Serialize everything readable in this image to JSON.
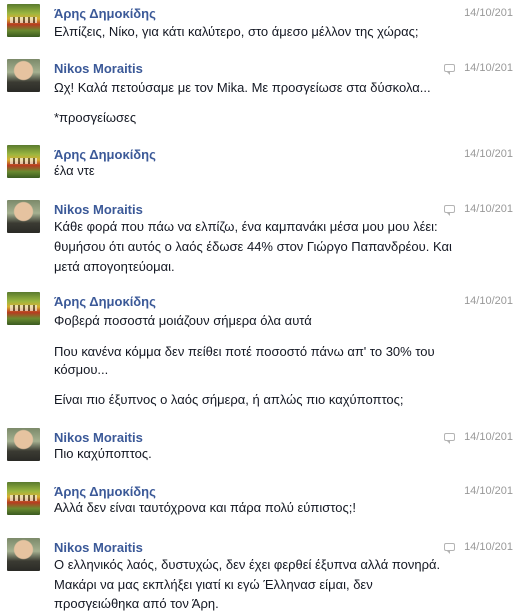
{
  "messages": [
    {
      "author": "Άρης Δημοκίδης",
      "avatar": "aris-avatar",
      "time": "14/10/201",
      "chat_icon": false,
      "lines": [
        "Ελπίζεις, Νίκο, για κάτι καλύτερο, στο άμεσο μέλλον της χώρας;"
      ]
    },
    {
      "author": "Nikos Moraitis",
      "avatar": "nikos-avatar",
      "time": "14/10/201",
      "chat_icon": true,
      "lines": [
        "Ωχ! Καλά πετούσαμε με τον Mika. Με προσγείωσε στα δύσκολα...",
        "*προσγείωσες"
      ]
    },
    {
      "author": "Άρης Δημοκίδης",
      "avatar": "aris-avatar",
      "time": "14/10/201",
      "chat_icon": false,
      "lines": [
        "έλα ντε"
      ]
    },
    {
      "author": "Nikos Moraitis",
      "avatar": "nikos-avatar",
      "time": "14/10/201",
      "chat_icon": true,
      "lines": [
        "Κάθε φορά που πάω να ελπίζω, ένα καμπανάκι μέσα μου μου λέει:",
        "θυμήσου ότι αυτός ο λαός έδωσε 44% στον Γιώργο Παπανδρέου. Και",
        "μετά απογοητεύομαι."
      ]
    },
    {
      "author": "Άρης Δημοκίδης",
      "avatar": "aris-avatar",
      "time": "14/10/201",
      "chat_icon": false,
      "lines": [
        "Φοβερά ποσοστά μοιάζουν σήμερα όλα αυτά",
        "Που κανένα κόμμα δεν πείθει ποτέ ποσοστό πάνω απ' το 30% του",
        "κόσμου...",
        "Είναι πιο έξυπνος ο λαός σήμερα, ή απλώς πιο καχύποπτος;"
      ]
    },
    {
      "author": "Nikos Moraitis",
      "avatar": "nikos-avatar",
      "time": "14/10/201",
      "chat_icon": true,
      "lines": [
        "Πιο καχύποπτος."
      ]
    },
    {
      "author": "Άρης Δημοκίδης",
      "avatar": "aris-avatar",
      "time": "14/10/201",
      "chat_icon": false,
      "lines": [
        "Αλλά δεν είναι ταυτόχρονα και πάρα πολύ εύπιστος;!"
      ]
    },
    {
      "author": "Nikos Moraitis",
      "avatar": "nikos-avatar",
      "time": "14/10/201",
      "chat_icon": true,
      "lines": [
        "Ο ελληνικός λαός, δυστυχώς, δεν έχει φερθεί έξυπνα αλλά πονηρά.",
        "Μακάρι να μας εκπλήξει γιατί κι εγώ Έλληνασ είμαι, δεν",
        "προσγειώθηκα από τον Άρη."
      ]
    }
  ]
}
